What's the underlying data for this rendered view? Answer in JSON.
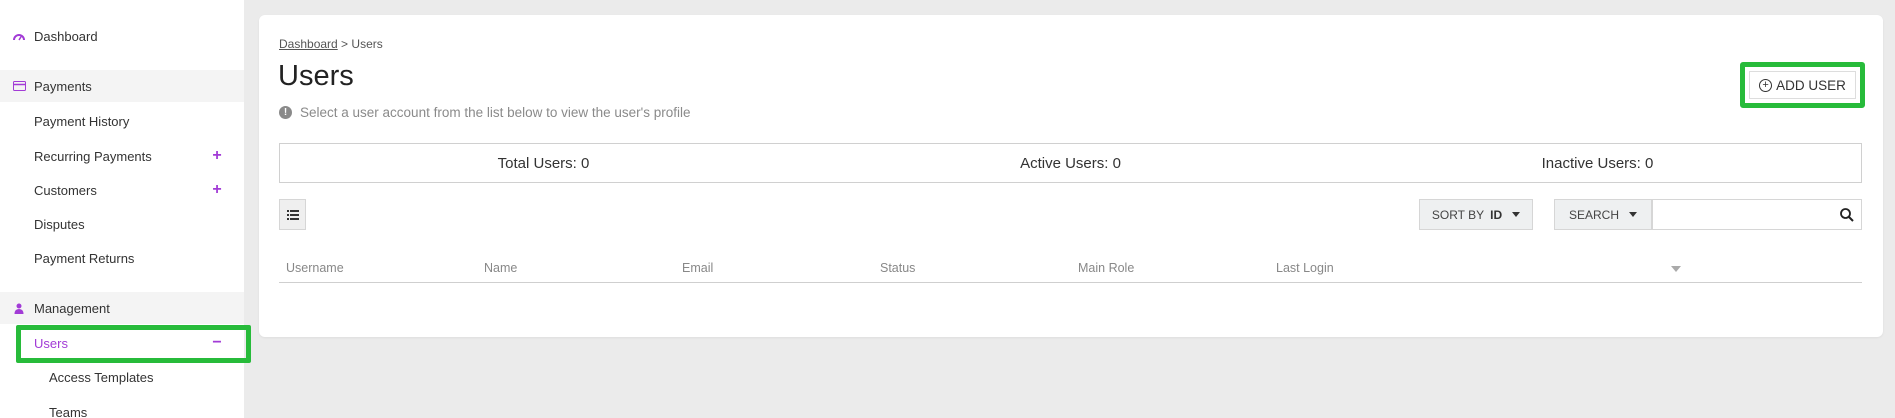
{
  "sidebar": {
    "items": [
      {
        "label": "Dashboard",
        "icon": "dashboard-icon"
      },
      {
        "label": "Payments",
        "icon": "credit-card-icon"
      },
      {
        "label": "Payment History"
      },
      {
        "label": "Recurring Payments",
        "action": "+"
      },
      {
        "label": "Customers",
        "action": "+"
      },
      {
        "label": "Disputes"
      },
      {
        "label": "Payment Returns"
      },
      {
        "label": "Management",
        "icon": "person-icon"
      },
      {
        "label": "Users",
        "action": "−"
      },
      {
        "label": "Access Templates"
      },
      {
        "label": "Teams"
      }
    ]
  },
  "breadcrumb": {
    "parent": "Dashboard",
    "separator": " > ",
    "current": "Users"
  },
  "page": {
    "title": "Users",
    "hint": "Select a user account from the list below to view the user's profile",
    "add_user_label": "ADD USER"
  },
  "stats": {
    "total": "Total Users: 0",
    "active": "Active Users: 0",
    "inactive": "Inactive Users: 0"
  },
  "toolbar": {
    "sort_label": "SORT BY",
    "sort_value": "ID",
    "search_label": "SEARCH",
    "search_value": ""
  },
  "table": {
    "columns": [
      "Username",
      "Name",
      "Email",
      "Status",
      "Main Role",
      "Last Login"
    ],
    "rows": []
  },
  "colors": {
    "accent": "#a23bd6",
    "highlight": "#27bb3a"
  }
}
